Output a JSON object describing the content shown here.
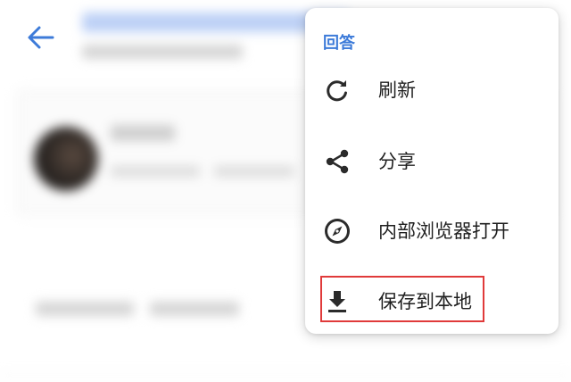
{
  "menu": {
    "header": "回答",
    "items": [
      {
        "label": "刷新",
        "icon": "refresh-icon"
      },
      {
        "label": "分享",
        "icon": "share-icon"
      },
      {
        "label": "内部浏览器打开",
        "icon": "compass-icon"
      },
      {
        "label": "保存到本地",
        "icon": "download-icon"
      }
    ]
  },
  "highlight": {
    "target": "保存到本地",
    "color": "#e03a3a"
  },
  "colors": {
    "accent": "#3d7bd9",
    "text": "#1f1f1f",
    "icon": "#2b2b2b"
  },
  "toolbar": {
    "back_icon": "arrow-left-icon"
  }
}
